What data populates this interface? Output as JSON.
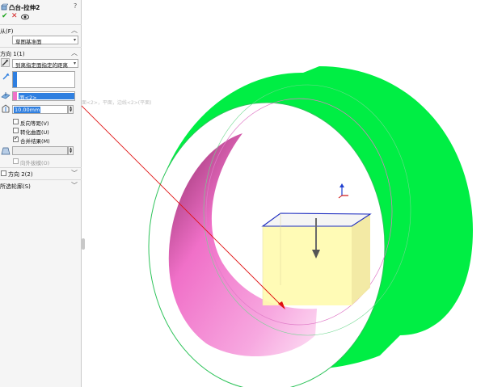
{
  "panel": {
    "title": "凸台-拉伸2",
    "from_label": "从(F)",
    "from_value": "草图基准面",
    "direction1_label": "方向 1(1)",
    "end_condition": "到离指定面指定的距离",
    "face_item": "面<2>",
    "distance": "10.00mm",
    "reverse_offset": "反向等距(V)",
    "translate_surface": "转化曲面(U)",
    "merge_result": "合并结果(M)",
    "draft_outward": "向外拔模(O)",
    "direction2_label": "方向 2(2)",
    "selected_contours_label": "所选轮廓(S)",
    "ghost_hint": "面<2>，平面，边线<2>(平面)"
  },
  "colors": {
    "accent": "#2f7fe0",
    "ok": "#1aa31a",
    "cancel": "#d42020",
    "tube_outer": "#00ee44",
    "tube_inner": "#f070c8",
    "box_fill": "#fffbb0",
    "arrow": "#e01010"
  },
  "icons": [
    "extrude-icon",
    "ok-check-icon",
    "cancel-x-icon",
    "preview-eye-icon",
    "end-condition-icon",
    "direction-arrow-icon",
    "face-icon",
    "distance-icon",
    "draft-icon",
    "triad-icon"
  ]
}
